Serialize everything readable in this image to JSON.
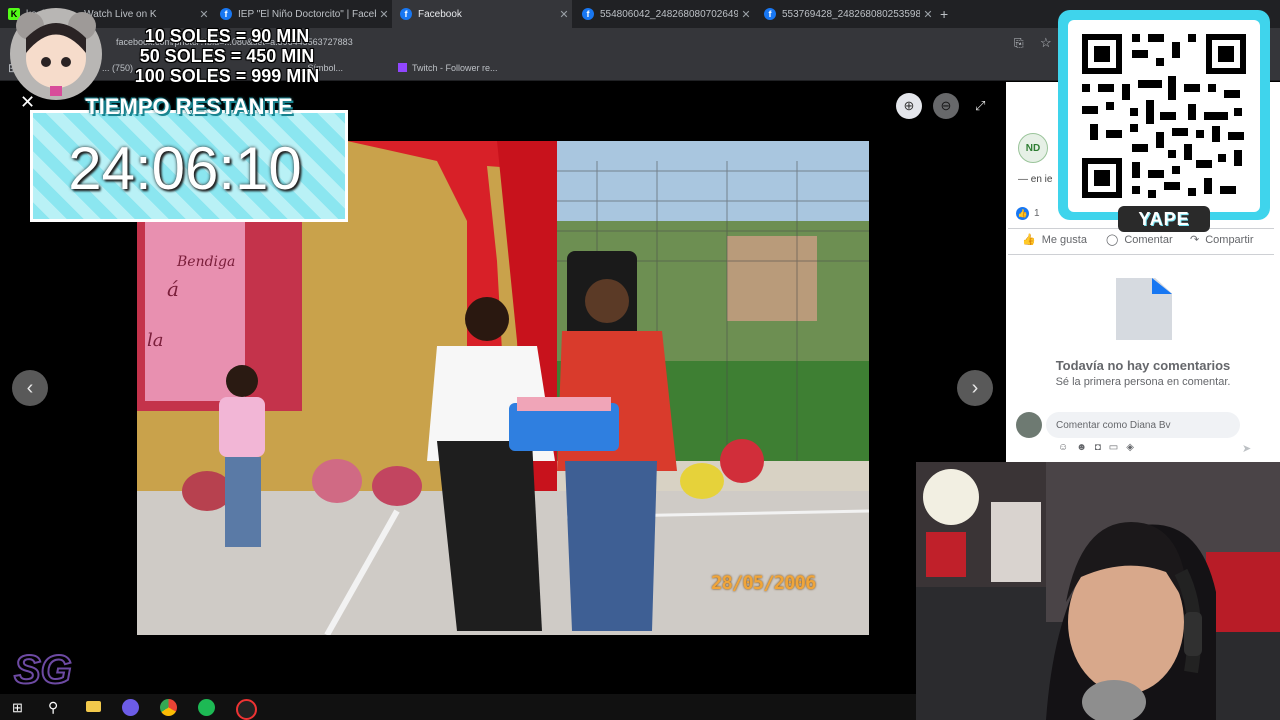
{
  "browser": {
    "tabs": [
      {
        "title": "koality.com - Watch Live on K",
        "favicon": "kick-icon",
        "active": false
      },
      {
        "title": "IEP \"El Niño Doctorcito\" | Faceb",
        "favicon": "facebook-icon",
        "active": false
      },
      {
        "title": "Facebook",
        "favicon": "facebook-icon",
        "active": true
      },
      {
        "title": "554806042_248268080702649",
        "favicon": "facebook-icon",
        "active": false
      },
      {
        "title": "553769428_248268080253598",
        "favicon": "facebook-icon",
        "active": false
      }
    ],
    "new_tab_symbol": "+",
    "close_symbol": "✕",
    "url": "facebook.com/photo/?fbid=...080&set=a.396445563727883",
    "bookmarks": [
      "... (750)",
      "...Símbol...",
      "Twitch - Follower re..."
    ]
  },
  "viewer": {
    "close_symbol": "✕",
    "prev_symbol": "‹",
    "next_symbol": "›",
    "photo_date_stamp": "28/05/2006",
    "banner_text_fragments": [
      "Bendiga",
      "á",
      "la"
    ]
  },
  "post_panel": {
    "page_initials": "ND",
    "caption_fragment": "— en ie",
    "reactions_count": "1",
    "actions": {
      "like": "Me gusta",
      "comment": "Comentar",
      "share": "Compartir"
    },
    "empty_title": "Todavía no hay comentarios",
    "empty_subtitle": "Sé la primera persona en comentar.",
    "comment_placeholder": "Comentar como Diana Bv"
  },
  "overlay": {
    "prices": [
      "10 SOLES = 90 MIN",
      "50 SOLES = 450 MIN",
      "100 SOLES = 999 MIN"
    ],
    "timer_title": "TIEMPO RESTANTE",
    "timer_value": "24:06:10",
    "qr_label": "YAPE",
    "watermark": "SG"
  },
  "colors": {
    "timer_stripe_a": "#8be6f0",
    "timer_stripe_b": "#b9f1f6",
    "qr_frame": "#3fd4ec",
    "facebook_blue": "#1877f2",
    "date_stamp": "#f0a53a"
  }
}
